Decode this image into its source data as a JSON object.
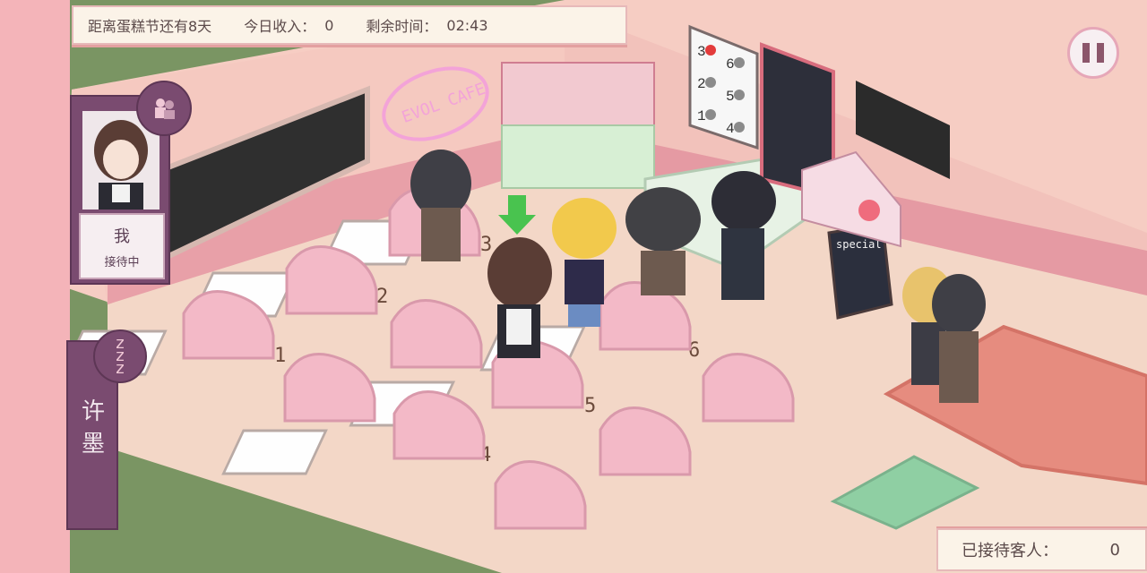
{
  "top_bar": {
    "event_countdown": "距离蛋糕节还有8天",
    "income_label": "今日收入：",
    "income_value": "0",
    "time_label": "剩余时间：",
    "time_value": "02:43"
  },
  "player_card": {
    "name": "我",
    "status": "接待中"
  },
  "side_tab": {
    "label": "许墨"
  },
  "served_counter": {
    "label": "已接待客人：",
    "value": "0"
  },
  "cafe_sign": "EVOL CAFE",
  "special_board": "special",
  "table_numbers": [
    "1",
    "2",
    "3",
    "4",
    "5",
    "6"
  ],
  "floor_indicator": [
    "3",
    "6",
    "2",
    "5",
    "1",
    "4"
  ],
  "icons": [
    "pause-icon",
    "group-icon",
    "sleep-icon",
    "down-arrow-icon"
  ],
  "colors": {
    "accent_pink": "#e9a9b6",
    "panel_purple": "#7a4b70",
    "wall_pink": "#f5c9c0",
    "floor": "#f3d7c7"
  }
}
